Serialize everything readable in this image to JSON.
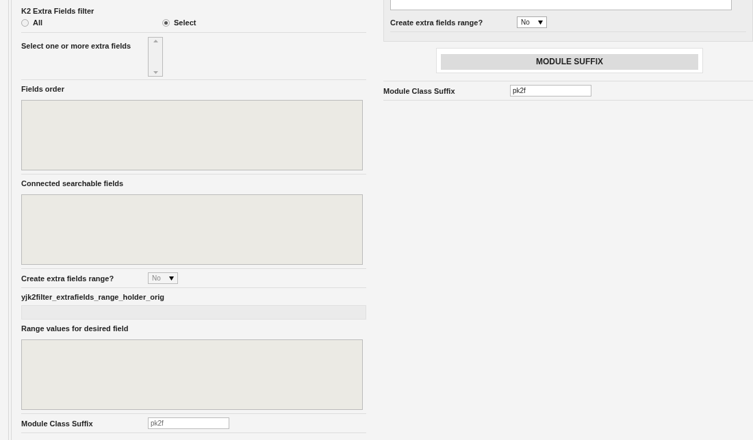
{
  "left": {
    "title": "K2 Extra Fields filter",
    "radios": [
      {
        "label": "All",
        "selected": false
      },
      {
        "label": "Select",
        "selected": true
      }
    ],
    "fields": [
      {
        "kind": "listbox",
        "label": "Select one or more extra fields"
      },
      {
        "kind": "textarea",
        "label": "Fields order"
      },
      {
        "kind": "textarea",
        "label": "Connected searchable fields"
      },
      {
        "kind": "select",
        "label": "Create extra fields range?",
        "value": "No",
        "disabled": true
      },
      {
        "kind": "readonly",
        "label": "yjk2filter_extrafields_range_holder_orig"
      },
      {
        "kind": "textarea",
        "label": "Range values for desired field"
      },
      {
        "kind": "text",
        "label": "Module Class Suffix",
        "value": "pk2f",
        "disabled": true
      }
    ]
  },
  "right": {
    "fields": [
      {
        "kind": "select",
        "label": "Create extra fields range?",
        "value": "No",
        "disabled": false
      }
    ],
    "section_button": "MODULE SUFFIX",
    "suffix": {
      "kind": "text",
      "label": "Module Class Suffix",
      "value": "pk2f",
      "disabled": false
    }
  }
}
